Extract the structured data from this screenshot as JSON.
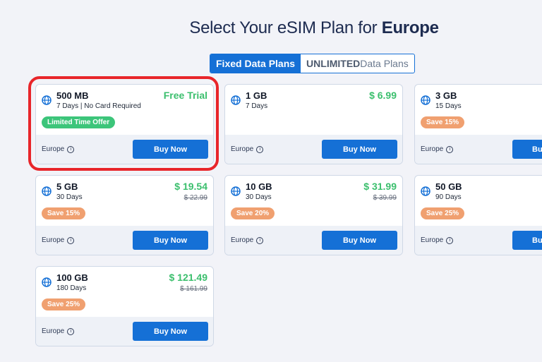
{
  "header": {
    "title_prefix": "Select Your eSIM Plan for ",
    "title_region": "Europe"
  },
  "tabs": {
    "fixed_label": "Fixed Data Plans",
    "unlimited_strong": "UNLIMITED",
    "unlimited_rest": " Data Plans"
  },
  "plans": [
    {
      "data": "500 MB",
      "duration": "7 Days | No Card Required",
      "price": "Free Trial",
      "old_price": "",
      "badge": "Limited Time Offer",
      "badge_color": "#3cc57a",
      "region": "Europe",
      "button": "Buy Now",
      "icon": "globe-icon"
    },
    {
      "data": "1 GB",
      "duration": "7 Days",
      "price": "$ 6.99",
      "old_price": "",
      "badge": "",
      "badge_color": "",
      "region": "Europe",
      "button": "Buy Now",
      "icon": "globe-icon"
    },
    {
      "data": "3 GB",
      "duration": "15 Days",
      "price": "",
      "old_price": "",
      "badge": "Save 15%",
      "badge_color": "#f0a070",
      "region": "Europe",
      "button": "Bu",
      "icon": "globe-icon"
    },
    {
      "data": "5 GB",
      "duration": "30 Days",
      "price": "$ 19.54",
      "old_price": "$ 22.99",
      "badge": "Save 15%",
      "badge_color": "#f0a070",
      "region": "Europe",
      "button": "Buy Now",
      "icon": "globe-icon"
    },
    {
      "data": "10 GB",
      "duration": "30 Days",
      "price": "$ 31.99",
      "old_price": "$ 39.99",
      "badge": "Save 20%",
      "badge_color": "#f0a070",
      "region": "Europe",
      "button": "Buy Now",
      "icon": "globe-icon"
    },
    {
      "data": "50 GB",
      "duration": "90 Days",
      "price": "",
      "old_price": "",
      "badge": "Save 25%",
      "badge_color": "#f0a070",
      "region": "Europe",
      "button": "Bu",
      "icon": "globe-icon"
    },
    {
      "data": "100 GB",
      "duration": "180 Days",
      "price": "$ 121.49",
      "old_price": "$ 161.99",
      "badge": "Save 25%",
      "badge_color": "#f0a070",
      "region": "Europe",
      "button": "Buy Now",
      "icon": "globe-icon"
    }
  ],
  "colors": {
    "accent": "#1570d6",
    "price_green": "#3bbf6d",
    "highlight_red": "#e8252a"
  }
}
